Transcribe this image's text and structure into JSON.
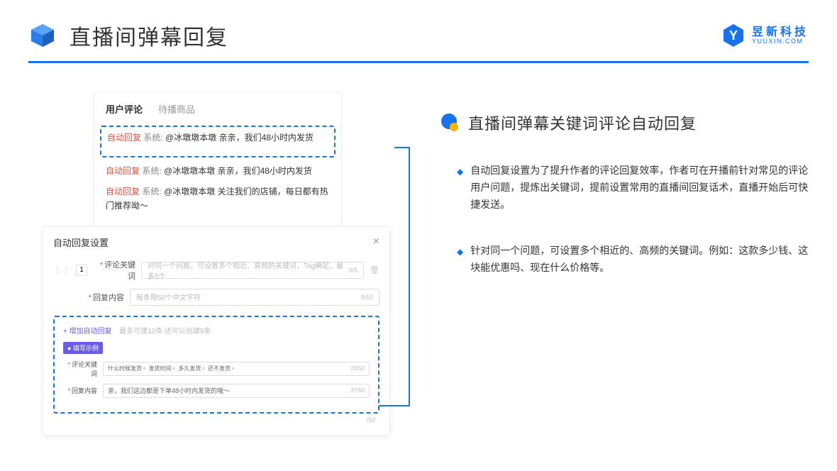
{
  "header": {
    "title": "直播间弹幕回复",
    "logo_cn": "昱新科技",
    "logo_en": "YUUXIN.COM"
  },
  "comment_panel": {
    "tabs": [
      "用户评论",
      "待播商品"
    ],
    "items": [
      {
        "auto": "自动回复",
        "sys": "系统:",
        "text": "@冰墩墩本墩 亲亲，我们48小时内发货"
      },
      {
        "auto": "自动回复",
        "sys": "系统:",
        "text": "@冰墩墩本墩 亲亲，我们48小时内发货"
      },
      {
        "auto": "自动回复",
        "sys": "系统:",
        "text": "@冰墩墩本墩 关注我们的店铺，每日都有热门推荐呦～"
      }
    ]
  },
  "settings": {
    "title": "自动回复设置",
    "row_num": "1",
    "keyword_label": "评论关键词",
    "keyword_ph": "对同一个问题，可设置多个相近、高频的关键词，Tag确定，最多5个",
    "keyword_count": "0/5",
    "content_label": "回复内容",
    "content_ph": "每条限50个中文字符",
    "content_count": "0/50",
    "add_link": "+ 增加自动回复",
    "add_hint": "最多可建10条 还可以创建9条",
    "example_badge": "● 填写示例",
    "ex_keyword_label": "评论关键词",
    "ex_tags": [
      "什么时候发货",
      "发货时间",
      "多久发货",
      "还不发货"
    ],
    "ex_kw_count": "20/50",
    "ex_content_label": "回复内容",
    "ex_content_text": "亲，我们这边都是下单48小时内发货的哦～",
    "ex_content_count": "37/50",
    "outer_count": "/50"
  },
  "right": {
    "section_title": "直播间弹幕关键词评论自动回复",
    "bullets": [
      "自动回复设置为了提升作者的评论回复效率，作者可在开播前针对常见的评论用户问题，提炼出关键词，提前设置常用的直播间回复话术，直播开始后可快捷发送。",
      "针对同一个问题，可设置多个相近的、高频的关键词。例如：这款多少钱、这块能优惠吗、现在什么价格等。"
    ]
  }
}
